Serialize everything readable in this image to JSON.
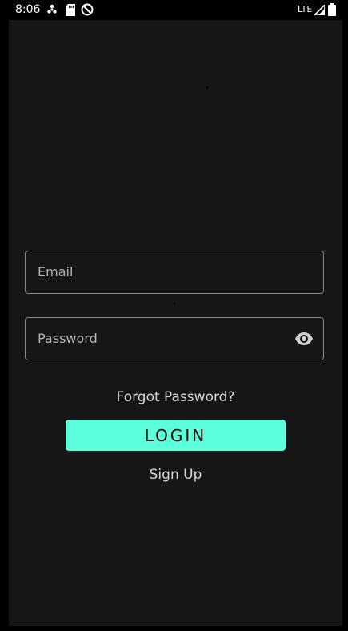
{
  "status_bar": {
    "time": "8:06",
    "network": "LTE",
    "icons": [
      "fan-icon",
      "sd-card-icon",
      "do-not-disturb-icon",
      "signal-icon",
      "battery-icon"
    ]
  },
  "login": {
    "email_placeholder": "Email",
    "password_placeholder": "Password",
    "forgot_label": "Forgot Password?",
    "login_label": "LOGIN",
    "signup_label": "Sign Up"
  },
  "colors": {
    "background": "#161616",
    "accent": "#5cfedb",
    "field_border": "#8a8a8a",
    "text_muted": "#d6d6d6"
  }
}
